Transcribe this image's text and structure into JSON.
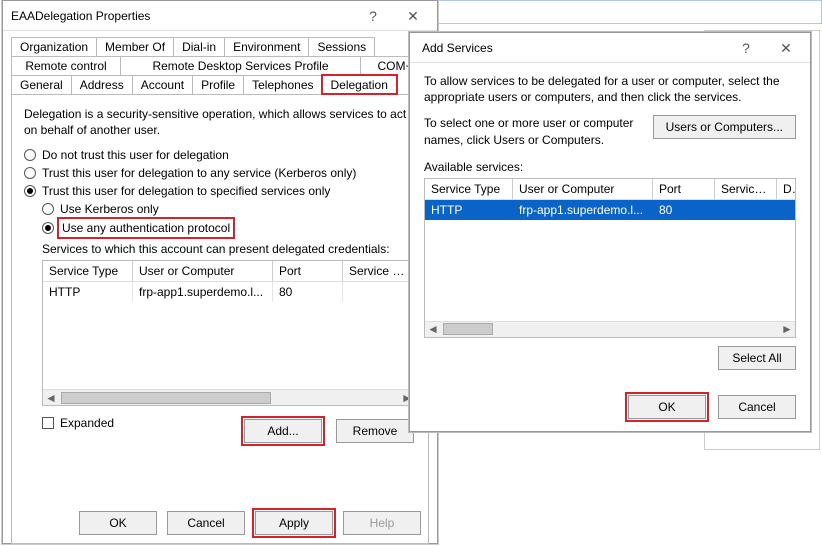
{
  "props_dialog": {
    "title": "EAADelegation Properties",
    "help_icon": "?",
    "close_icon": "✕",
    "tabs_row1": [
      "Organization",
      "Member Of",
      "Dial-in",
      "Environment",
      "Sessions"
    ],
    "tabs_row2": [
      "Remote control",
      "Remote Desktop Services Profile",
      "COM+"
    ],
    "tabs_row3": [
      "General",
      "Address",
      "Account",
      "Profile",
      "Telephones",
      "Delegation"
    ],
    "description": "Delegation is a security-sensitive operation, which allows services to act on behalf of another user.",
    "radios": {
      "no_trust": "Do not trust this user for delegation",
      "any_service": "Trust this user for delegation to any service (Kerberos only)",
      "specified": "Trust this user for delegation to specified services only",
      "kerberos_only": "Use Kerberos only",
      "any_auth": "Use any authentication protocol"
    },
    "subhead": "Services to which this account can present delegated credentials:",
    "svc_headers": {
      "type": "Service Type",
      "uc": "User or Computer",
      "port": "Port",
      "name": "Service N..."
    },
    "svc_rows": [
      {
        "type": "HTTP",
        "uc": "frp-app1.superdemo.l...",
        "port": "80",
        "name": ""
      }
    ],
    "expanded": "Expanded",
    "buttons": {
      "add": "Add...",
      "remove": "Remove",
      "ok": "OK",
      "cancel": "Cancel",
      "apply": "Apply",
      "help": "Help"
    }
  },
  "add_dialog": {
    "title": "Add Services",
    "help_icon": "?",
    "close_icon": "✕",
    "instr": "To allow services to be delegated for a user or computer, select the appropriate users or computers, and then click the services.",
    "uc_instr": "To select one or more user or computer names, click Users or Computers.",
    "uc_button": "Users or Computers...",
    "avail_label": "Available services:",
    "svc_headers": {
      "type": "Service Type",
      "uc": "User or Computer",
      "port": "Port",
      "sn": "Service Name",
      "d": "D"
    },
    "svc_rows": [
      {
        "type": "HTTP",
        "uc": "frp-app1.superdemo.l...",
        "port": "80",
        "sn": "",
        "d": ""
      }
    ],
    "select_all": "Select All",
    "ok": "OK",
    "cancel": "Cancel"
  }
}
